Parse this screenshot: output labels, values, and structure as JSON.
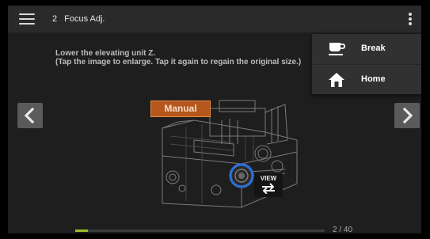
{
  "header": {
    "step_number": "2",
    "step_title": "Focus Adj."
  },
  "instruction": {
    "line1": "Lower the elevating unit Z.",
    "line2": "(Tap the image to enlarge. Tap it again to regain the original size.)"
  },
  "figure": {
    "mode_badge": "Manual",
    "view_button_label": "VIEW"
  },
  "menu": {
    "items": [
      {
        "label": "Break",
        "icon": "coffee-cup-icon"
      },
      {
        "label": "Home",
        "icon": "home-icon"
      }
    ]
  },
  "footer": {
    "progress_current": 2,
    "progress_total": 40,
    "page_indicator": "2 / 40"
  },
  "colors": {
    "accent_progress": "#9bbf2a",
    "badge": "#b5561c",
    "highlight_ring": "#2d6fd8"
  }
}
